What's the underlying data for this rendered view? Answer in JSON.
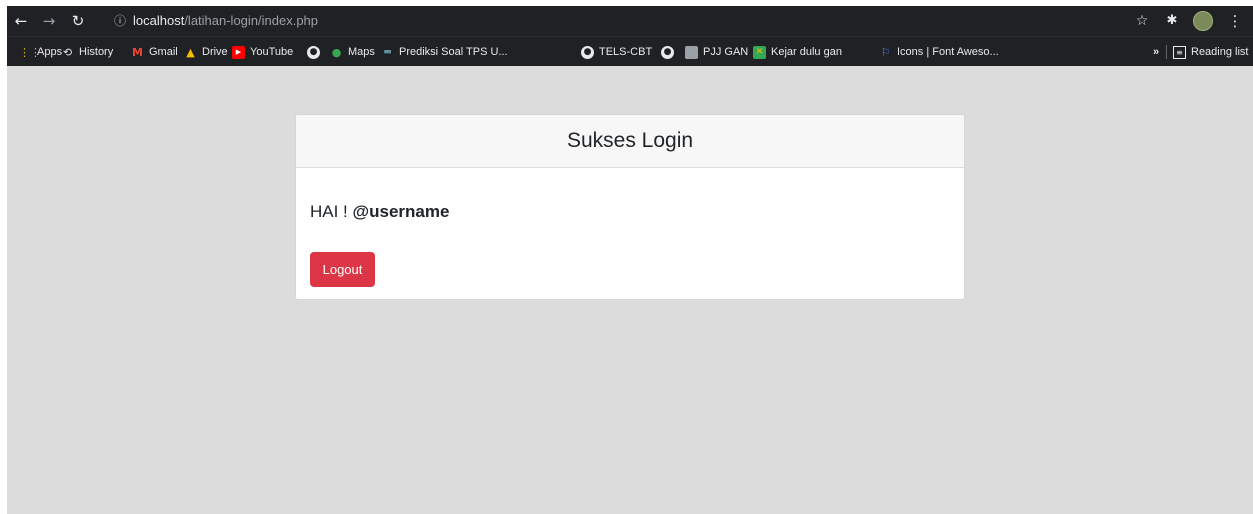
{
  "browser": {
    "url_host": "localhost",
    "url_path": "/latihan-login/index.php",
    "reading_list_label": "Reading list",
    "more_bookmarks_label": "»"
  },
  "bookmarks": [
    {
      "label": "Apps",
      "icon": "apps-grid-icon",
      "color": "#f4b400"
    },
    {
      "label": "History",
      "icon": "history-icon",
      "color": "#e8eaed"
    },
    {
      "label": "Gmail",
      "icon": "gmail-icon",
      "color": "#ea4335"
    },
    {
      "label": "Drive",
      "icon": "drive-icon",
      "color": "#34a853"
    },
    {
      "label": "YouTube",
      "icon": "youtube-icon",
      "color": "#ff0000"
    },
    {
      "label": "",
      "icon": "globe-icon",
      "color": "#e8eaed"
    },
    {
      "label": "Maps",
      "icon": "maps-icon",
      "color": "#34a853"
    },
    {
      "label": "Prediksi Soal TPS U...",
      "icon": "prediksi-icon",
      "color": "#5f8fa0"
    },
    {
      "label": "TELS-CBT",
      "icon": "globe-icon",
      "color": "#e8eaed"
    },
    {
      "label": "",
      "icon": "globe-icon",
      "color": "#e8eaed"
    },
    {
      "label": "PJJ GAN",
      "icon": "pjj-icon",
      "color": "#9aa0a6"
    },
    {
      "label": "Kejar dulu gan",
      "icon": "kejar-icon",
      "color": "#34a853"
    },
    {
      "label": "Icons | Font Aweso...",
      "icon": "flag-icon",
      "color": "#4285f4"
    }
  ],
  "page": {
    "card_title": "Sukses Login",
    "greeting_prefix": "HAI !",
    "username": "@username",
    "logout_label": "Logout"
  },
  "colors": {
    "danger": "#dc3545",
    "page_bg": "#dcdcdc",
    "chrome_bg": "#202124"
  }
}
